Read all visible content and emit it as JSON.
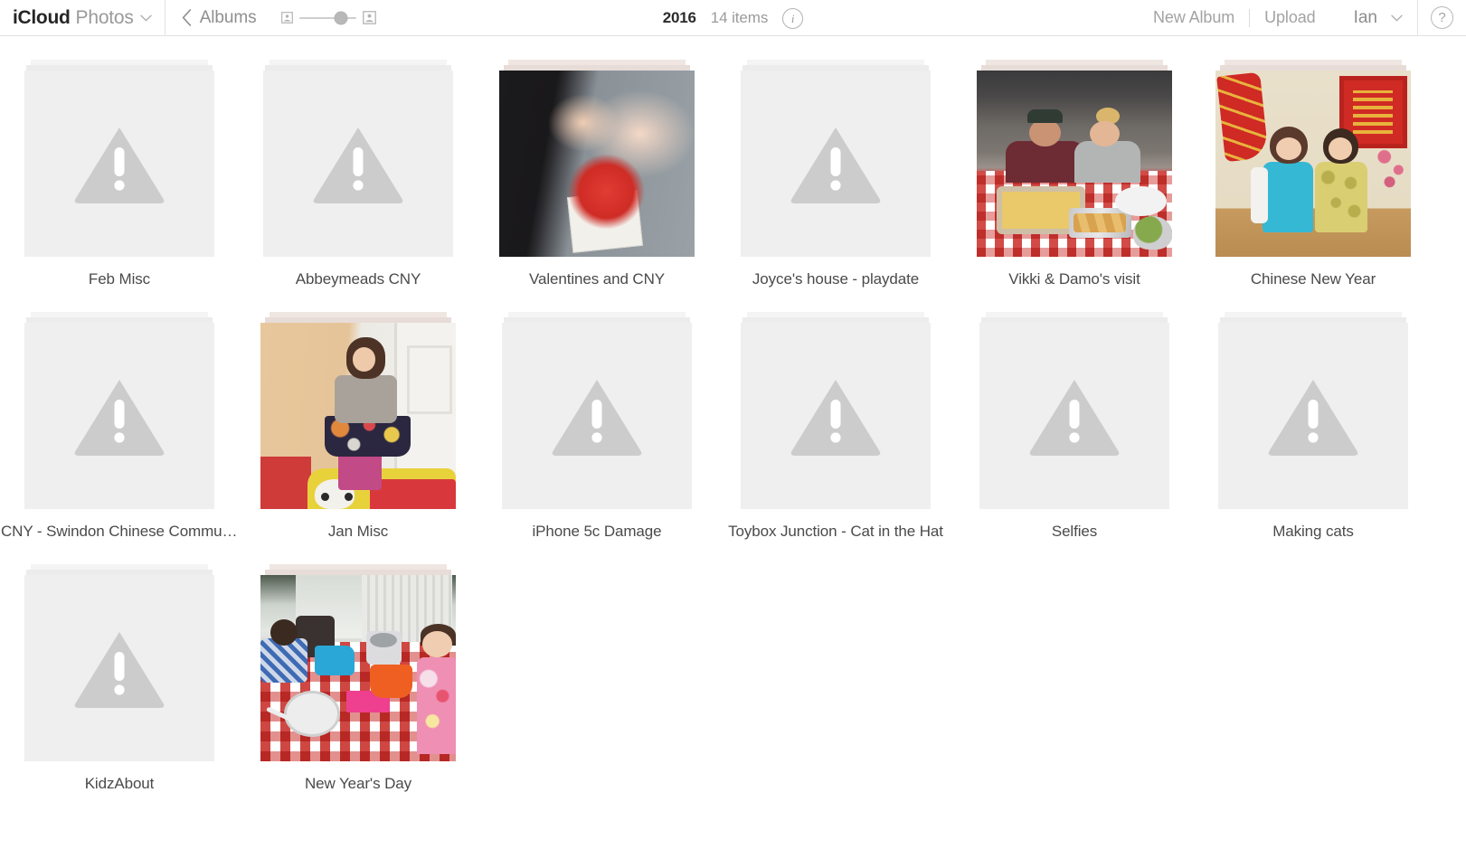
{
  "toolbar": {
    "brand_primary": "iCloud",
    "brand_app": "Photos",
    "brand_caret_icon": "chevron-down-icon",
    "back_chevron_icon": "chevron-left-icon",
    "back_label": "Albums",
    "zoom_slider": {
      "small_icon": "small-thumbnail-icon",
      "large_icon": "large-thumbnail-icon",
      "value": 62
    },
    "year": "2016",
    "item_count": "14 items",
    "info_icon": "info-icon",
    "info_glyph": "i",
    "new_album_label": "New Album",
    "upload_label": "Upload",
    "account_name": "Ian",
    "account_caret_icon": "chevron-down-icon",
    "help_icon": "help-icon",
    "help_glyph": "?"
  },
  "albums": [
    {
      "label": "Feb Misc",
      "cover": "placeholder",
      "broken_icon": "broken-image-warning-icon"
    },
    {
      "label": "Abbeymeads CNY",
      "cover": "placeholder",
      "broken_icon": "broken-image-warning-icon"
    },
    {
      "label": "Valentines and CNY",
      "cover": "photo",
      "photo_class": "ph-valentines"
    },
    {
      "label": "Joyce's house - playdate",
      "cover": "placeholder",
      "broken_icon": "broken-image-warning-icon"
    },
    {
      "label": "Vikki & Damo's visit",
      "cover": "photo",
      "photo_class": "ph-vikki"
    },
    {
      "label": "Chinese New Year",
      "cover": "photo",
      "photo_class": "ph-cny"
    },
    {
      "label": "CNY - Swindon Chinese Communit...",
      "cover": "placeholder",
      "broken_icon": "broken-image-warning-icon"
    },
    {
      "label": "Jan Misc",
      "cover": "photo",
      "photo_class": "ph-janmisc"
    },
    {
      "label": "iPhone 5c Damage",
      "cover": "placeholder",
      "broken_icon": "broken-image-warning-icon"
    },
    {
      "label": "Toybox Junction - Cat in the Hat",
      "cover": "placeholder",
      "broken_icon": "broken-image-warning-icon"
    },
    {
      "label": "Selfies",
      "cover": "placeholder",
      "broken_icon": "broken-image-warning-icon"
    },
    {
      "label": "Making cats",
      "cover": "placeholder",
      "broken_icon": "broken-image-warning-icon"
    },
    {
      "label": "KidzAbout",
      "cover": "placeholder",
      "broken_icon": "broken-image-warning-icon"
    },
    {
      "label": "New Year's Day",
      "cover": "photo",
      "photo_class": "ph-nyd"
    }
  ],
  "colors": {
    "background": "#ffffff",
    "toolbar_border": "#e2e2e2",
    "label_text": "#4a4a4a",
    "muted_text": "#9b9b9b",
    "placeholder_fill": "#efefef",
    "placeholder_glyph": "#cccccc"
  }
}
